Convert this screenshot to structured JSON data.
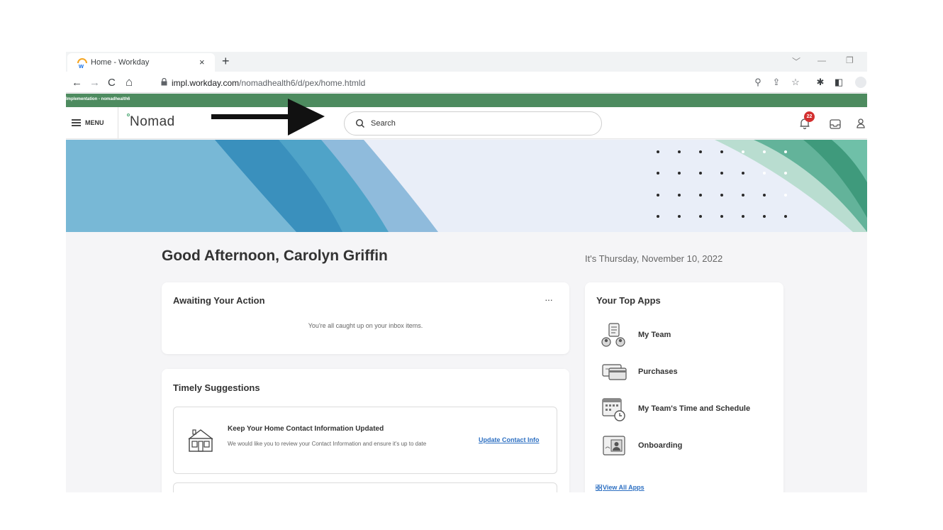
{
  "browser": {
    "tab_title": "Home - Workday",
    "tab_close": "×",
    "new_tab": "+",
    "url_host": "impl.workday.com",
    "url_path": "/nomadhealth6/d/pex/home.htmld",
    "nav_back": "←",
    "nav_forward": "→",
    "nav_reload": "C",
    "nav_home": "⌂"
  },
  "environment": {
    "label": "Implementation - nomadhealth6"
  },
  "header": {
    "menu_label": "MENU",
    "logo_text": "Nomad",
    "search_placeholder": "Search",
    "notification_count": "22"
  },
  "home": {
    "greeting": "Good Afternoon, Carolyn Griffin",
    "date_text": "It's Thursday, November 10, 2022"
  },
  "awaiting_action": {
    "title": "Awaiting Your Action",
    "more_label": "···",
    "empty_message": "You're all caught up on your inbox items."
  },
  "timely_suggestions": {
    "title": "Timely Suggestions",
    "items": [
      {
        "title": "Keep Your Home Contact Information Updated",
        "description": "We would like you to review your Contact Information and ensure it's up to date",
        "action": "Update Contact Info",
        "icon": "house-icon"
      }
    ]
  },
  "top_apps": {
    "title": "Your Top Apps",
    "items": [
      {
        "label": "My Team",
        "icon": "team-icon"
      },
      {
        "label": "Purchases",
        "icon": "purchases-icon"
      },
      {
        "label": "My Team's Time and Schedule",
        "icon": "calendar-clock-icon"
      },
      {
        "label": "Onboarding",
        "icon": "onboarding-icon"
      }
    ],
    "view_all": "View All Apps"
  },
  "colors": {
    "env_bar": "#4d8b5f",
    "link": "#2c6fc2",
    "badge": "#d32f2f",
    "banner_bg": "#e9eef8"
  }
}
